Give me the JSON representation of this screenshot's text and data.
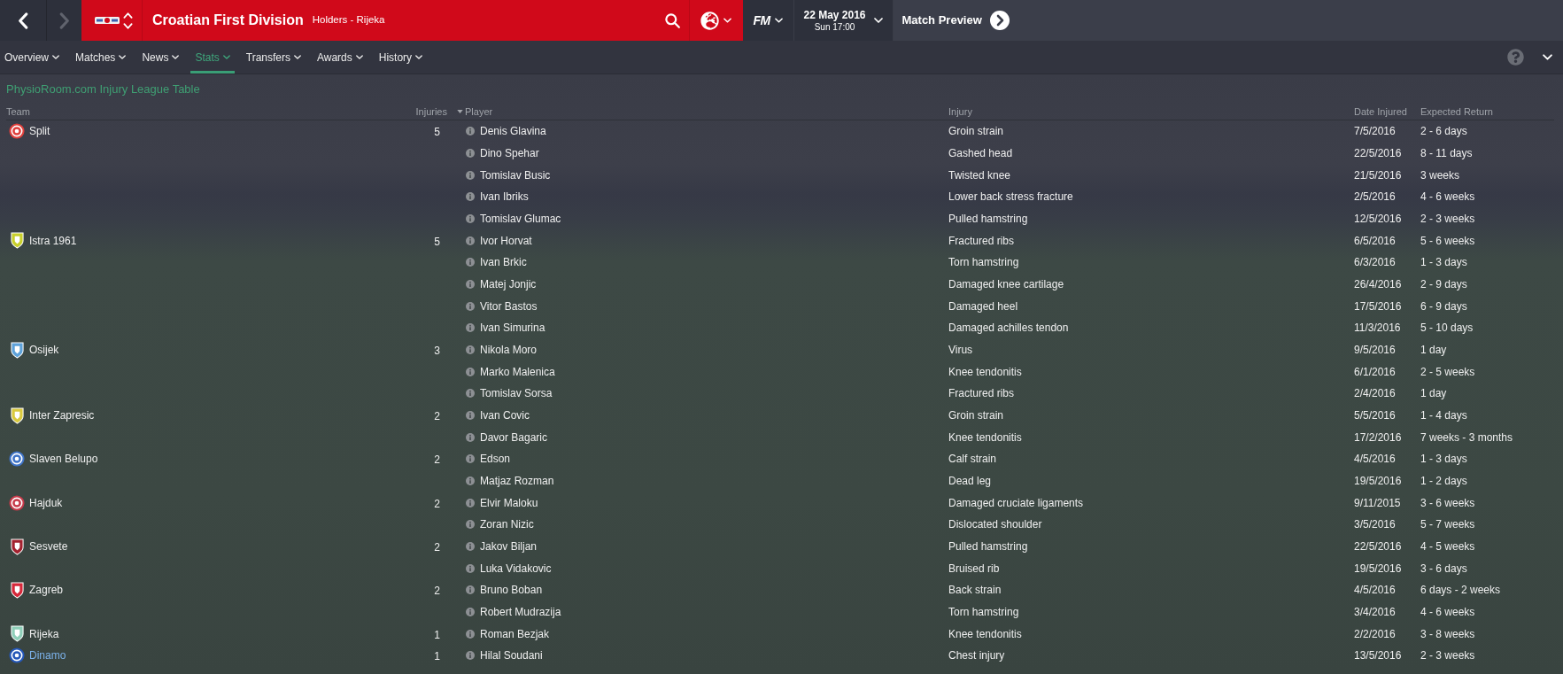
{
  "header": {
    "back": {
      "disabled": false
    },
    "forward": {
      "disabled": true
    },
    "title": "Croatian First Division",
    "subtitle": "Holders - Rijeka",
    "brand": "FM",
    "date": "22 May 2016",
    "time": "Sun 17:00",
    "action": "Match Preview"
  },
  "nav": {
    "tabs": [
      {
        "label": "Overview",
        "selected": false
      },
      {
        "label": "Matches",
        "selected": false
      },
      {
        "label": "News",
        "selected": false
      },
      {
        "label": "Stats",
        "selected": true
      },
      {
        "label": "Transfers",
        "selected": false
      },
      {
        "label": "Awards",
        "selected": false
      },
      {
        "label": "History",
        "selected": false
      }
    ]
  },
  "page_title": "PhysioRoom.com Injury League Table",
  "table": {
    "columns": [
      {
        "label": "Team",
        "sorted": false
      },
      {
        "label": "Injuries",
        "sorted": false
      },
      {
        "label": "Player",
        "sorted": true
      },
      {
        "label": "Injury",
        "sorted": false
      },
      {
        "label": "Date Injured",
        "sorted": false
      },
      {
        "label": "Expected Return",
        "sorted": false
      }
    ],
    "teams": [
      {
        "name": "Split",
        "injuries": "5",
        "kind": "round",
        "color": "#e0403c",
        "highlighted": false,
        "players": [
          {
            "name": "Denis Glavina",
            "injury": "Groin strain",
            "date_injured": "7/5/2016",
            "expected_return": "2 - 6 days"
          },
          {
            "name": "Dino Spehar",
            "injury": "Gashed head",
            "date_injured": "22/5/2016",
            "expected_return": "8 - 11 days"
          },
          {
            "name": "Tomislav Busic",
            "injury": "Twisted knee",
            "date_injured": "21/5/2016",
            "expected_return": "3 weeks"
          },
          {
            "name": "Ivan Ibriks",
            "injury": "Lower back stress fracture",
            "date_injured": "2/5/2016",
            "expected_return": "4 - 6 weeks"
          },
          {
            "name": "Tomislav Glumac",
            "injury": "Pulled hamstring",
            "date_injured": "12/5/2016",
            "expected_return": "2 - 3 weeks"
          }
        ]
      },
      {
        "name": "Istra 1961",
        "injuries": "5",
        "kind": "shield",
        "color": "#c8cf2c",
        "highlighted": false,
        "players": [
          {
            "name": "Ivor Horvat",
            "injury": "Fractured ribs",
            "date_injured": "6/5/2016",
            "expected_return": "5 - 6 weeks"
          },
          {
            "name": "Ivan Brkic",
            "injury": "Torn hamstring",
            "date_injured": "6/3/2016",
            "expected_return": "1 - 3 days"
          },
          {
            "name": "Matej Jonjic",
            "injury": "Damaged knee cartilage",
            "date_injured": "26/4/2016",
            "expected_return": "2 - 9 days"
          },
          {
            "name": "Vitor Bastos",
            "injury": "Damaged heel",
            "date_injured": "17/5/2016",
            "expected_return": "6 - 9 days"
          },
          {
            "name": "Ivan Simurina",
            "injury": "Damaged achilles tendon",
            "date_injured": "11/3/2016",
            "expected_return": "5 - 10 days"
          }
        ]
      },
      {
        "name": "Osijek",
        "injuries": "3",
        "kind": "shield",
        "color": "#5ea2da",
        "highlighted": false,
        "players": [
          {
            "name": "Nikola Moro",
            "injury": "Virus",
            "date_injured": "9/5/2016",
            "expected_return": "1 day"
          },
          {
            "name": "Marko Malenica",
            "injury": "Knee tendonitis",
            "date_injured": "6/1/2016",
            "expected_return": "2 - 5 weeks"
          },
          {
            "name": "Tomislav Sorsa",
            "injury": "Fractured ribs",
            "date_injured": "2/4/2016",
            "expected_return": "1 day"
          }
        ]
      },
      {
        "name": "Inter Zapresic",
        "injuries": "2",
        "kind": "shield",
        "color": "#d9c93e",
        "highlighted": false,
        "players": [
          {
            "name": "Ivan Covic",
            "injury": "Groin strain",
            "date_injured": "5/5/2016",
            "expected_return": "1 - 4 days"
          },
          {
            "name": "Davor Bagaric",
            "injury": "Knee tendonitis",
            "date_injured": "17/2/2016",
            "expected_return": "7 weeks - 3 months"
          }
        ]
      },
      {
        "name": "Slaven Belupo",
        "injuries": "2",
        "kind": "round",
        "color": "#3f74c8",
        "highlighted": false,
        "players": [
          {
            "name": "Edson",
            "injury": "Calf strain",
            "date_injured": "4/5/2016",
            "expected_return": "1 - 3 days"
          },
          {
            "name": "Matjaz Rozman",
            "injury": "Dead leg",
            "date_injured": "19/5/2016",
            "expected_return": "1 - 2 days"
          }
        ]
      },
      {
        "name": "Hajduk",
        "injuries": "2",
        "kind": "round",
        "color": "#c73a4a",
        "highlighted": false,
        "players": [
          {
            "name": "Elvir Maloku",
            "injury": "Damaged cruciate ligaments",
            "date_injured": "9/11/2015",
            "expected_return": "3 - 6 weeks"
          },
          {
            "name": "Zoran Nizic",
            "injury": "Dislocated shoulder",
            "date_injured": "3/5/2016",
            "expected_return": "5 - 7 weeks"
          }
        ]
      },
      {
        "name": "Sesvete",
        "injuries": "2",
        "kind": "shield",
        "color": "#a3222f",
        "highlighted": false,
        "players": [
          {
            "name": "Jakov Biljan",
            "injury": "Pulled hamstring",
            "date_injured": "22/5/2016",
            "expected_return": "4 - 5 weeks"
          },
          {
            "name": "Luka Vidakovic",
            "injury": "Bruised rib",
            "date_injured": "19/5/2016",
            "expected_return": "3 - 6 days"
          }
        ]
      },
      {
        "name": "Zagreb",
        "injuries": "2",
        "kind": "shield",
        "color": "#d6283a",
        "highlighted": false,
        "players": [
          {
            "name": "Bruno Boban",
            "injury": "Back strain",
            "date_injured": "4/5/2016",
            "expected_return": "6 days - 2 weeks"
          },
          {
            "name": "Robert Mudrazija",
            "injury": "Torn hamstring",
            "date_injured": "3/4/2016",
            "expected_return": "4 - 6 weeks"
          }
        ]
      },
      {
        "name": "Rijeka",
        "injuries": "1",
        "kind": "shield",
        "color": "#8fcfb9",
        "highlighted": false,
        "players": [
          {
            "name": "Roman Bezjak",
            "injury": "Knee tendonitis",
            "date_injured": "2/2/2016",
            "expected_return": "3 - 8 weeks"
          }
        ]
      },
      {
        "name": "Dinamo",
        "injuries": "1",
        "kind": "round",
        "color": "#2457b8",
        "highlighted": true,
        "players": [
          {
            "name": "Hilal Soudani",
            "injury": "Chest injury",
            "date_injured": "13/5/2016",
            "expected_return": "2 - 3 weeks"
          }
        ]
      }
    ]
  }
}
